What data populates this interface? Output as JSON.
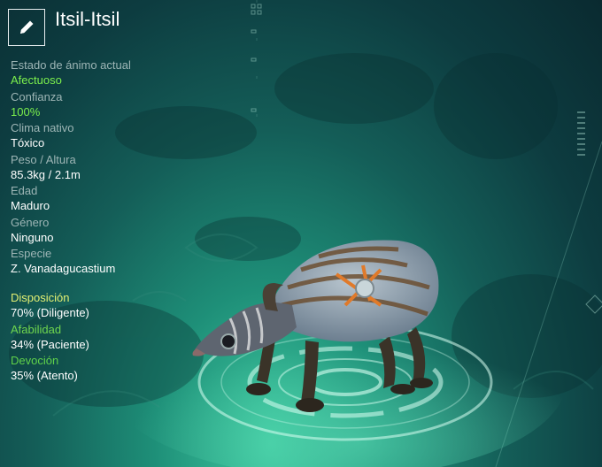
{
  "creature": {
    "name": "Itsil-Itsil"
  },
  "stats": [
    {
      "label": "Estado de ánimo actual",
      "value": "Afectuoso",
      "highlight": true
    },
    {
      "label": "Confianza",
      "value": "100%",
      "highlight": true
    },
    {
      "label": "Clima nativo",
      "value": "Tóxico",
      "highlight": false
    },
    {
      "label": "Peso / Altura",
      "value": "85.3kg / 2.1m",
      "highlight": false
    },
    {
      "label": "Edad",
      "value": "Maduro",
      "highlight": false
    },
    {
      "label": "Género",
      "value": "Ninguno",
      "highlight": false
    },
    {
      "label": "Especie",
      "value": "Z. Vanadagucastium",
      "highlight": false
    }
  ],
  "traits": [
    {
      "label": "Disposición",
      "value": "70% (Diligente)",
      "color": "#e2ef72"
    },
    {
      "label": "Afabilidad",
      "value": "34% (Paciente)",
      "color": "#6fd64e"
    },
    {
      "label": "Devoción",
      "value": "35% (Atento)",
      "color": "#60d24a"
    }
  ],
  "colors": {
    "highlight_value": "#7cf04c",
    "label_gray": "#9db5b5",
    "background_teal": "#1e8f78"
  },
  "icons": {
    "edit": "pencil-icon"
  }
}
